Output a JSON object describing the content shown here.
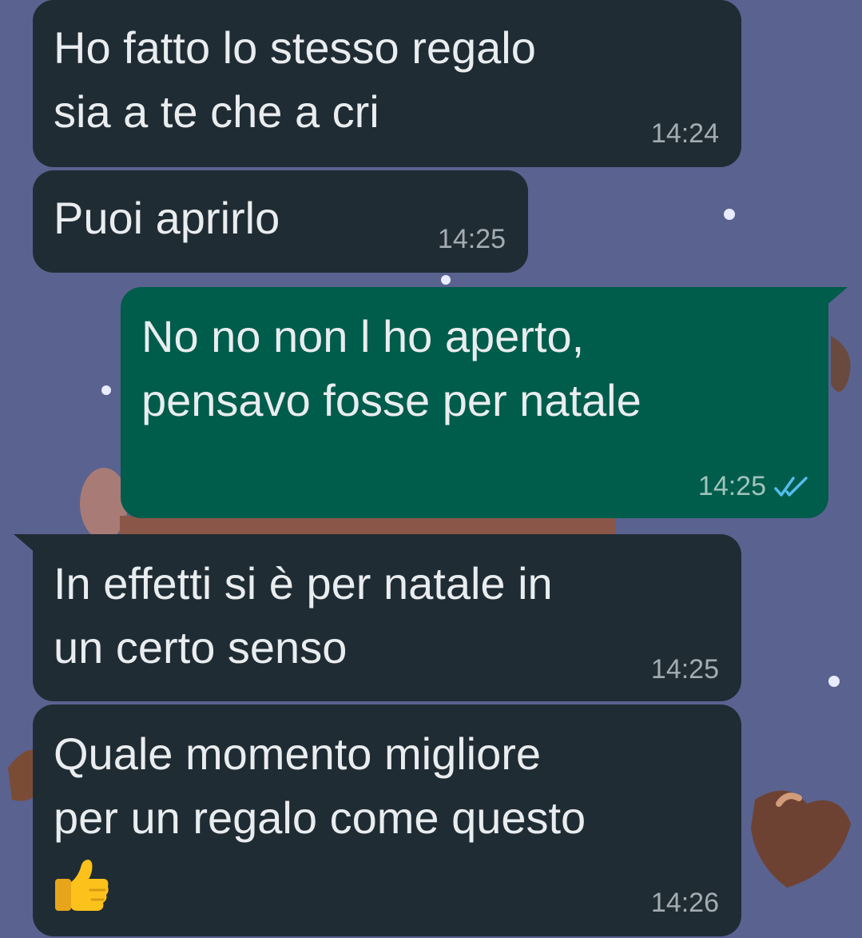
{
  "theme": {
    "wallpaper": "#5a6290",
    "incoming_bubble": "#202c33",
    "outgoing_bubble": "#005c4b",
    "text": "#e9edef",
    "read_ticks": "#53bdeb"
  },
  "messages": [
    {
      "direction": "incoming",
      "text": "Ho fatto lo stesso regalo\nsia a te che a cri",
      "time": "14:24"
    },
    {
      "direction": "incoming",
      "text": "Puoi aprirlo",
      "time": "14:25"
    },
    {
      "direction": "outgoing",
      "text": "No no non l ho aperto,\npensavo fosse per natale",
      "time": "14:25",
      "status_icon": "double-check-read-icon"
    },
    {
      "direction": "incoming",
      "text": "In effetti si è per natale in\nun certo senso",
      "time": "14:25"
    },
    {
      "direction": "incoming",
      "text": "Quale momento migliore\nper un regalo come questo",
      "time": "14:26",
      "emoji_icon": "thumbs-up-icon"
    }
  ]
}
